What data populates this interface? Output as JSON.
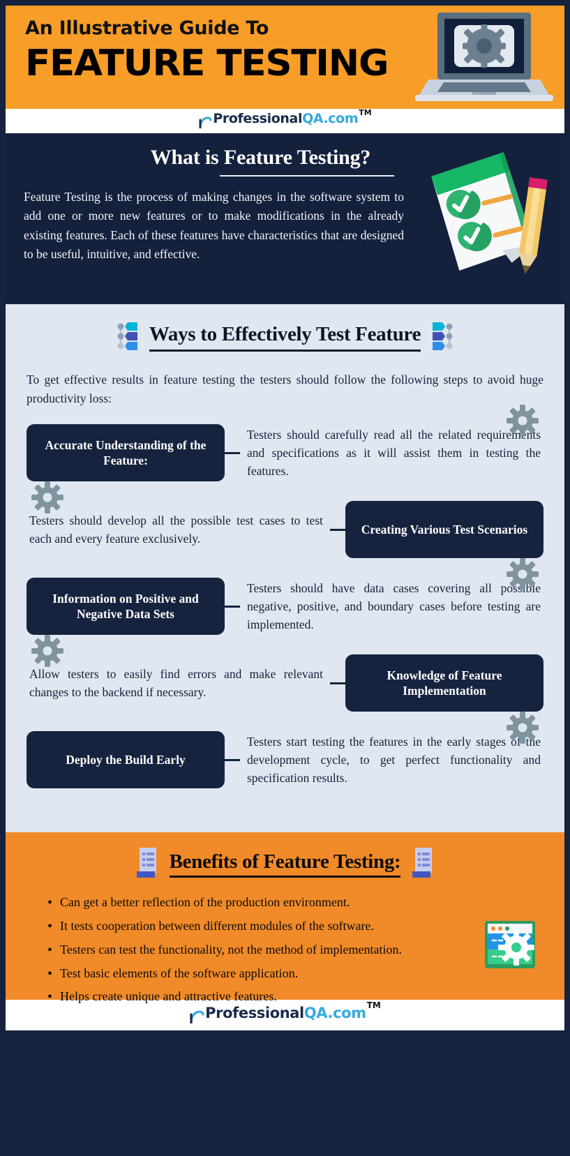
{
  "header": {
    "kicker": "An Illustrative Guide To",
    "title": "FEATURE TESTING",
    "laptop_icon": "laptop-gear-icon",
    "bg_color": "#f79d28"
  },
  "brand": {
    "name_dark": "Professional",
    "name_blue": "QA.com",
    "trademark": "TM",
    "arc_icon": "brand-arc-icon",
    "dark_color": "#1c2b4a",
    "blue_color": "#34a9e0"
  },
  "what_section": {
    "title": "What is Feature Testing?",
    "body": "Feature Testing is the process of making changes in the software system to add one or more new features or to make modifications in the already existing features. Each of these features have characteristics that are designed to be useful, intuitive, and effective.",
    "illustration_icon": "notepad-checklist-pencil-icon",
    "bg_color": "#14213d"
  },
  "ways_section": {
    "title": "Ways to Effectively Test Feature",
    "left_icon": "list-bars-icon",
    "right_icon": "list-bars-icon",
    "intro": "To get effective results in feature testing the testers should follow the following steps to avoid huge productivity loss:",
    "bg_color": "#e1e7f0",
    "steps": [
      {
        "side": "left",
        "label": "Accurate Understanding of the Feature:",
        "description": "Testers should carefully read all the related requirements and specifications as it will assist them in testing the features.",
        "icon": "gear-icon"
      },
      {
        "side": "right",
        "label": "Creating Various Test Scenarios",
        "description": "Testers should develop all the possible test cases to test each and every feature exclusively.",
        "icon": "gear-icon"
      },
      {
        "side": "left",
        "label": "Information on Positive and Negative Data Sets",
        "description": "Testers should have data cases covering all possible negative, positive, and boundary cases before testing are implemented.",
        "icon": "gear-icon"
      },
      {
        "side": "right",
        "label": "Knowledge of Feature Implementation",
        "description": "Allow testers to easily find errors and make relevant changes to the backend if necessary.",
        "icon": "gear-icon"
      },
      {
        "side": "left",
        "label": "Deploy the Build Early",
        "description": "Testers start testing the features in the early stages of the development cycle, to get perfect functionality and specification results.",
        "icon": "gear-icon"
      }
    ]
  },
  "benefits_section": {
    "title": "Benefits of Feature Testing:",
    "left_icon": "document-list-icon",
    "right_icon": "document-list-icon",
    "corner_icon": "browser-gear-icon",
    "bg_color": "#f18a28",
    "items": [
      "Can get a better reflection of the production environment.",
      "It tests cooperation between different modules of the software.",
      "Testers can test the functionality, not the method of implementation.",
      "Test basic elements of the software application.",
      " Helps create unique and attractive features."
    ]
  }
}
